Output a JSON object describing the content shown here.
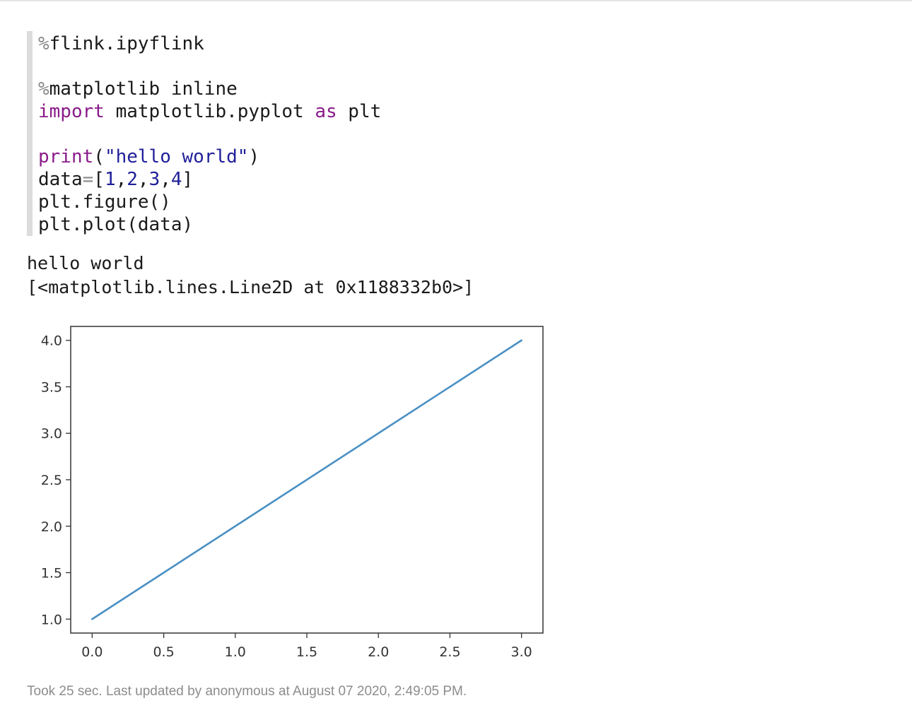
{
  "editor": {
    "lines": [
      [
        {
          "t": "%",
          "c": "op"
        },
        {
          "t": "flink.ipyflink",
          "c": "plain"
        }
      ],
      [],
      [
        {
          "t": "%",
          "c": "op"
        },
        {
          "t": "matplotlib inline",
          "c": "plain"
        }
      ],
      [
        {
          "t": "import",
          "c": "kw"
        },
        {
          "t": " matplotlib.pyplot ",
          "c": "plain"
        },
        {
          "t": "as",
          "c": "kw"
        },
        {
          "t": " plt",
          "c": "plain"
        }
      ],
      [],
      [
        {
          "t": "print",
          "c": "kw"
        },
        {
          "t": "(",
          "c": "plain"
        },
        {
          "t": "\"hello world\"",
          "c": "str"
        },
        {
          "t": ")",
          "c": "plain"
        }
      ],
      [
        {
          "t": "data",
          "c": "plain"
        },
        {
          "t": "=",
          "c": "op"
        },
        {
          "t": "[",
          "c": "plain"
        },
        {
          "t": "1",
          "c": "num"
        },
        {
          "t": ",",
          "c": "plain"
        },
        {
          "t": "2",
          "c": "num"
        },
        {
          "t": ",",
          "c": "plain"
        },
        {
          "t": "3",
          "c": "num"
        },
        {
          "t": ",",
          "c": "plain"
        },
        {
          "t": "4",
          "c": "num"
        },
        {
          "t": "]",
          "c": "plain"
        }
      ],
      [
        {
          "t": "plt.figure()",
          "c": "plain"
        }
      ],
      [
        {
          "t": "plt.plot(data)",
          "c": "plain"
        }
      ]
    ]
  },
  "output": {
    "stdout": "hello world",
    "repr": "[<matplotlib.lines.Line2D at 0x1188332b0>]"
  },
  "chart_data": {
    "type": "line",
    "series": [
      {
        "x": [
          0,
          1,
          2,
          3
        ],
        "values": [
          1,
          2,
          3,
          4
        ],
        "color": "#4a90c4"
      }
    ],
    "xlim": [
      -0.15,
      3.15
    ],
    "ylim": [
      0.85,
      4.15
    ],
    "x_ticks": [
      "0.0",
      "0.5",
      "1.0",
      "1.5",
      "2.0",
      "2.5",
      "3.0"
    ],
    "y_ticks": [
      "1.0",
      "1.5",
      "2.0",
      "2.5",
      "3.0",
      "3.5",
      "4.0"
    ],
    "grid": false
  },
  "footer": {
    "status": "Took 25 sec. Last updated by anonymous at August 07 2020, 2:49:05 PM."
  },
  "colors": {
    "keyword": "#8a1a8a",
    "string": "#1f1f9a",
    "operator": "#888888",
    "footer_text": "#8c8c8c"
  }
}
